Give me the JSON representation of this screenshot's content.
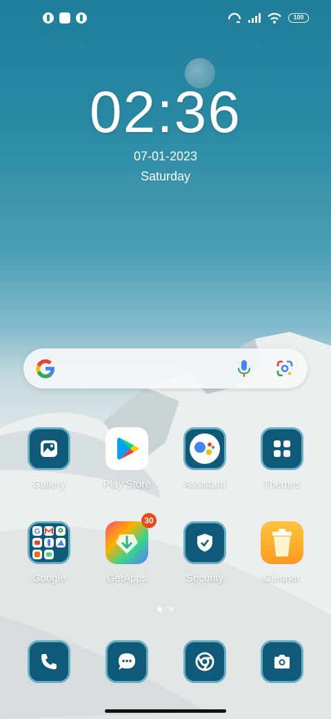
{
  "status_bar": {
    "battery": "100",
    "notification_icons": [
      "app-notification-icon",
      "square-notification-icon",
      "app-notification-icon"
    ],
    "right_icons": [
      "hotspot-icon",
      "signal-icon",
      "wifi-icon",
      "battery-icon"
    ]
  },
  "clock": {
    "time": "02:36",
    "date": "07-01-2023",
    "day": "Saturday"
  },
  "search": {
    "icons": [
      "google-g-icon",
      "mic-icon",
      "lens-icon"
    ]
  },
  "apps": [
    {
      "label": "Gallery",
      "icon": "gallery-icon"
    },
    {
      "label": "Play Store",
      "icon": "play-store-icon"
    },
    {
      "label": "Assistant",
      "icon": "assistant-icon"
    },
    {
      "label": "Themes",
      "icon": "themes-icon"
    },
    {
      "label": "Google",
      "icon": "folder-icon"
    },
    {
      "label": "GetApps",
      "icon": "getapps-icon",
      "badge": "30"
    },
    {
      "label": "Security",
      "icon": "shield-icon"
    },
    {
      "label": "Cleaner",
      "icon": "trash-icon"
    }
  ],
  "dock": [
    {
      "icon": "phone-icon"
    },
    {
      "icon": "messages-icon"
    },
    {
      "icon": "chrome-icon"
    },
    {
      "icon": "camera-icon"
    }
  ],
  "page_indicator": {
    "pages": 2,
    "active": 1
  },
  "colors": {
    "tile": "#0f5a78",
    "tile_border": "#6aaec3",
    "badge": "#e8491d"
  }
}
